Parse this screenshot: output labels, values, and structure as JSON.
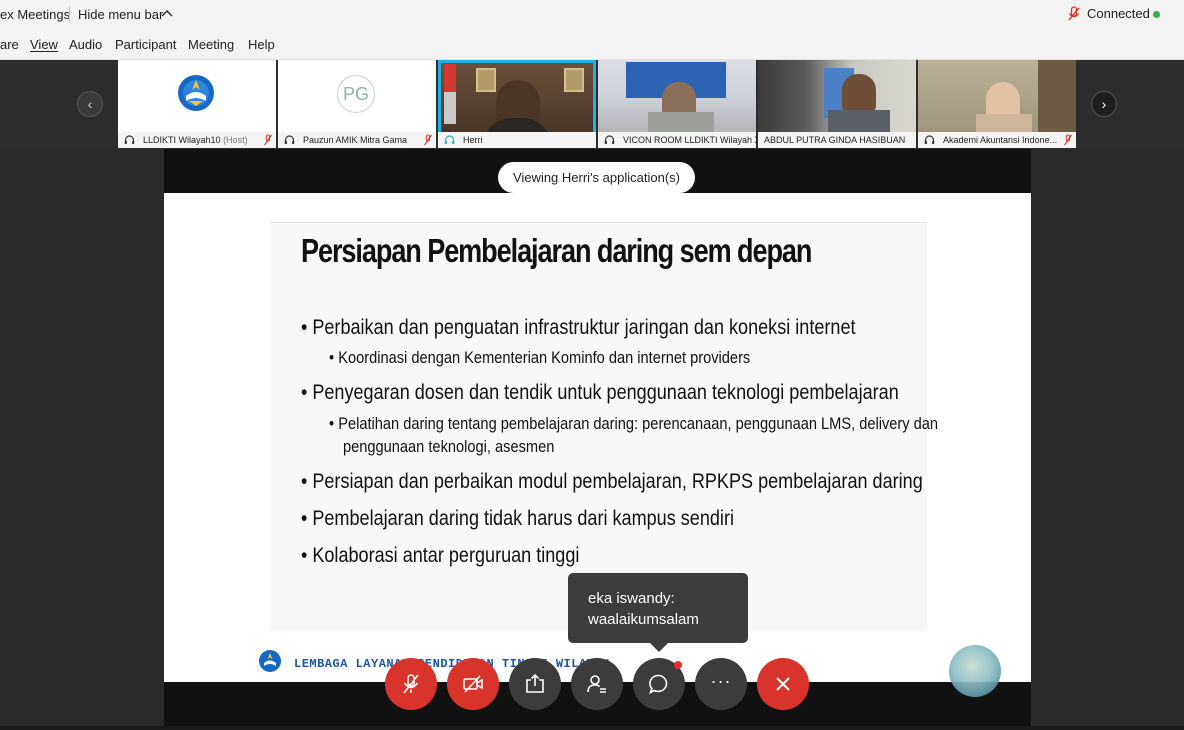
{
  "titlebar": {
    "app_title": "ex Meetings",
    "hide_menu": "Hide menu bar",
    "status": "Connected",
    "status_color": "#2fb34a"
  },
  "menubar": {
    "items": [
      "are",
      "View",
      "Audio",
      "Participant",
      "Meeting",
      "Help"
    ]
  },
  "participants": [
    {
      "name": "LLDIKTI Wilayah10",
      "suffix": "(Host)",
      "muted": true,
      "avatar_type": "logo"
    },
    {
      "name": "Pauzun AMIK Mitra Gama",
      "muted": true,
      "avatar_type": "initials",
      "initials": "PG"
    },
    {
      "name": "Herri",
      "muted": false,
      "active": true,
      "avatar_type": "video"
    },
    {
      "name": "VICON ROOM LLDIKTI Wilayah X",
      "muted": false,
      "avatar_type": "video"
    },
    {
      "name": "ABDUL PUTRA GINDA HASIBUAN",
      "muted": false,
      "avatar_type": "video"
    },
    {
      "name": "Akademi Akuntansi Indone...",
      "muted": true,
      "avatar_type": "video"
    }
  ],
  "share": {
    "viewing_label": "Viewing Herri's application(s)"
  },
  "slide": {
    "title": "Persiapan Pembelajaran daring sem depan",
    "bullets": [
      "Perbaikan dan penguatan infrastruktur jaringan dan koneksi internet",
      "Koordinasi dengan Kementerian Kominfo dan internet providers",
      "Penyegaran dosen dan tendik untuk penggunaan teknologi pembelajaran",
      "Pelatihan daring tentang pembelajaran daring: perencanaan, penggunaan LMS, delivery dan",
      "penggunaan teknologi, asesmen",
      "Persiapan dan perbaikan modul pembelajaran, RPKPS pembelajaran daring",
      "Pembelajaran daring tidak harus dari kampus sendiri",
      "Kolaborasi antar perguruan tinggi"
    ],
    "footer_text": "LEMBAGA LAYANAN PENDIDIKAN TINGGI WILAYAH"
  },
  "chat": {
    "sender": "eka iswandy:",
    "message": "waalaikumsalam"
  },
  "controls": {
    "mute": "unmute-mic",
    "video": "start-video",
    "share": "share-content",
    "participants": "participants",
    "chat": "chat",
    "more": "···",
    "leave": "leave-meeting"
  },
  "colors": {
    "accent_red": "#d9342b",
    "active_border": "#1fb0e6",
    "footer_blue": "#1a56a8"
  }
}
